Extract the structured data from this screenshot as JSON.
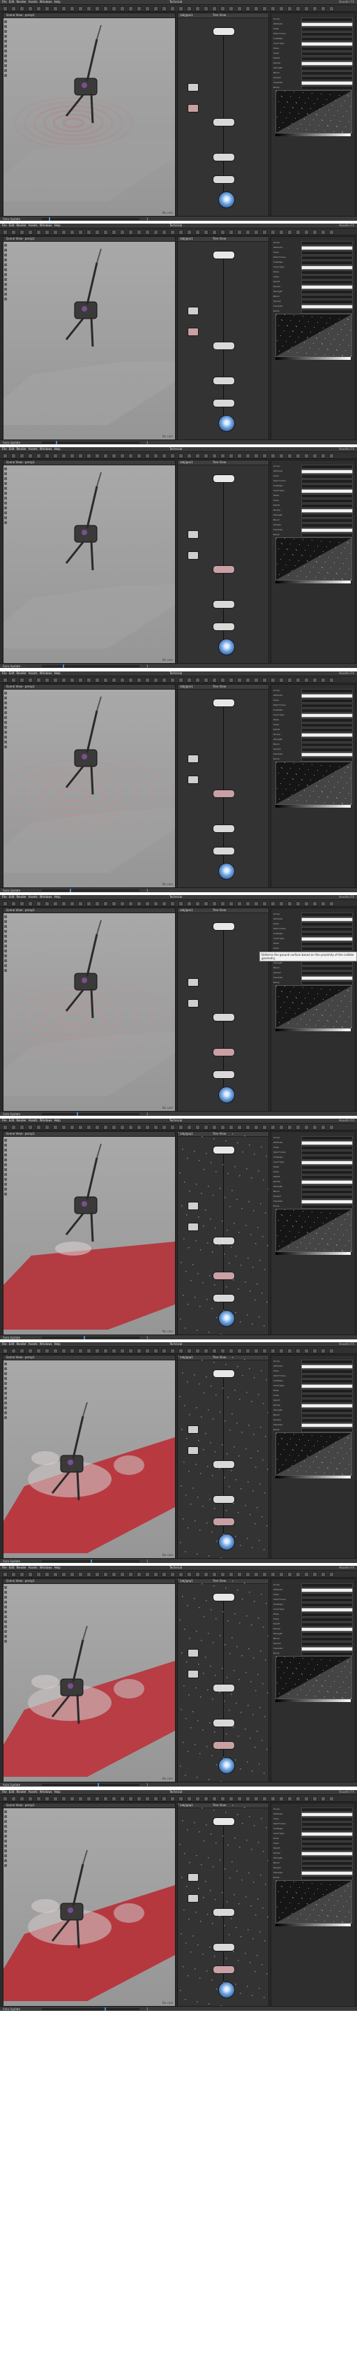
{
  "app": {
    "menu": [
      "File",
      "Edit",
      "Render",
      "Assets",
      "Windows",
      "Help"
    ],
    "desktop": "Technical",
    "build": "Houdini FX"
  },
  "viewport": {
    "tab": "Scene View",
    "camera": "persp1",
    "label": "No cam"
  },
  "network": {
    "tab": "/obj/geo1",
    "tab2": "Tree View"
  },
  "parameters": {
    "rows": [
      "Group",
      "Attribute",
      "Class",
      "Start Frame",
      "Substeps",
      "Input Type",
      "Mode",
      "Scale",
      "Falloff",
      "Radius",
      "Strength",
      "Blend",
      "Spread",
      "Visualize",
      "Ramp"
    ]
  },
  "status": {
    "mode": "Auto Update",
    "time": "1"
  },
  "frames": [
    {
      "pattern": "rings-soft",
      "plane": "#a0a0a0",
      "tint": "#b87c82",
      "selected": 1
    },
    {
      "pattern": "grid-light",
      "plane": "#a5a5a5",
      "tint": "#a39392",
      "selected": 1
    },
    {
      "pattern": "grid-faint",
      "plane": "#a4a4a4",
      "tint": "#a7a0a0",
      "selected": 2
    },
    {
      "pattern": "rings-wide",
      "plane": "#a3a3a3",
      "tint": "#c68e92",
      "selected": 2
    },
    {
      "pattern": "rings-wide",
      "plane": "#a3a3a3",
      "tint": "#c98f94",
      "selected": 3
    },
    {
      "pattern": "red-plane",
      "plane": "#b33b42",
      "tint": "#c4464e",
      "selected": 3
    },
    {
      "pattern": "red-deform",
      "plane": "#b83a40",
      "tint": "#c7484e",
      "selected": 4
    },
    {
      "pattern": "red-deform",
      "plane": "#b83d44",
      "tint": "#c24b51",
      "selected": 4
    },
    {
      "pattern": "red-deform",
      "plane": "#b6383f",
      "tint": "#c24950",
      "selected": 4
    }
  ],
  "tooltip": {
    "text": "Deforms the ground surface based on the proximity of the collider geometry."
  }
}
